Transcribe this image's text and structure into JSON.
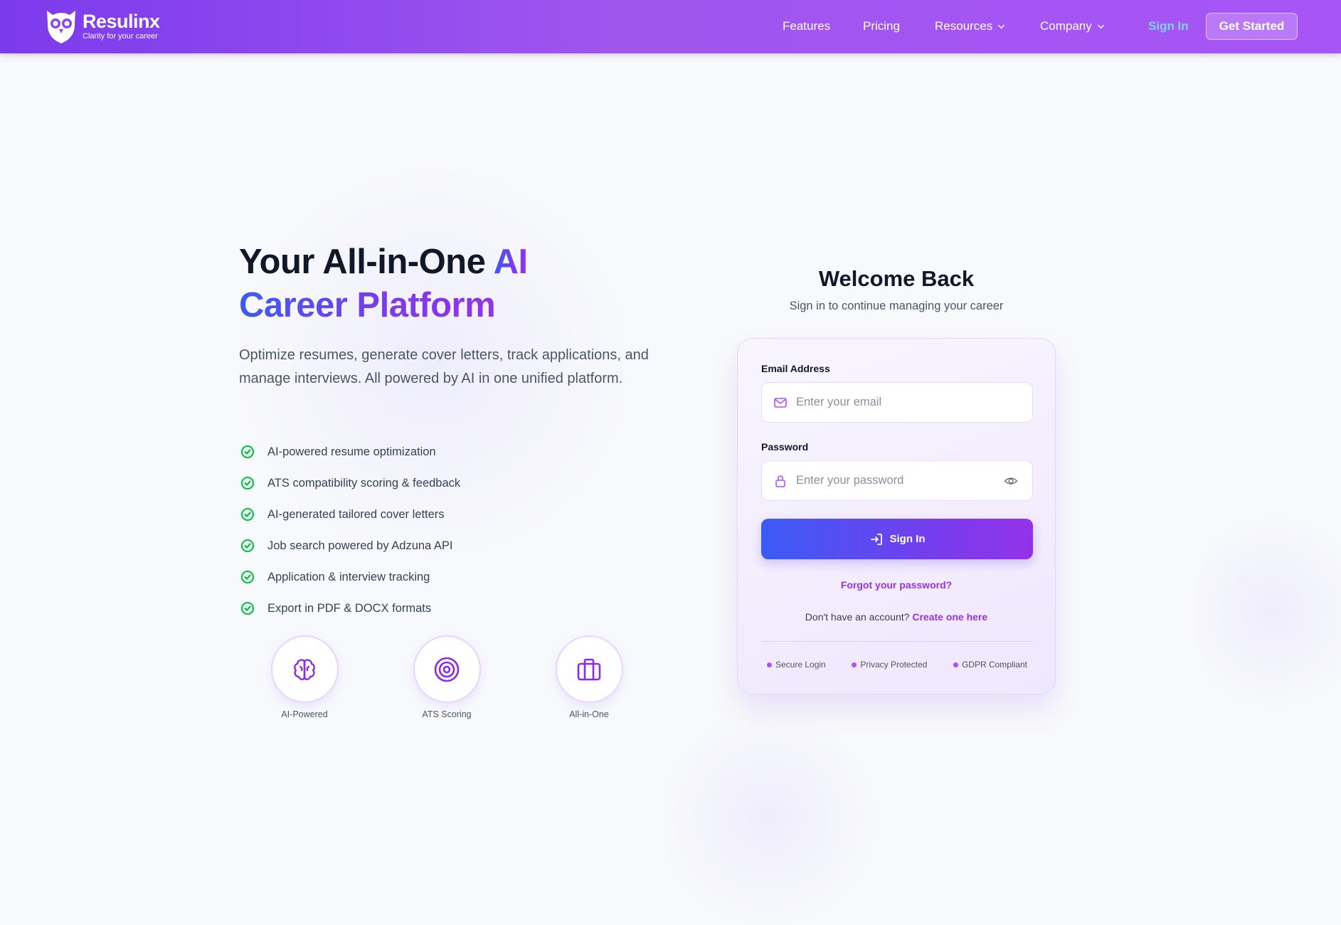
{
  "brand": {
    "name": "Resulinx",
    "tagline": "Clarity for your career"
  },
  "nav": {
    "links": [
      {
        "label": "Features"
      },
      {
        "label": "Pricing"
      },
      {
        "label": "Resources",
        "dropdown": true
      },
      {
        "label": "Company",
        "dropdown": true
      }
    ],
    "sign_in": "Sign In",
    "get_started": "Get Started"
  },
  "hero": {
    "title_part1": "Your All-in-One ",
    "title_highlight1": "AI",
    "title_highlight2": "Career Platform",
    "description": "Optimize resumes, generate cover letters, track applications, and manage interviews. All powered by AI in one unified platform.",
    "features": [
      "AI-powered resume optimization",
      "ATS compatibility scoring & feedback",
      "AI-generated tailored cover letters",
      "Job search powered by Adzuna API",
      "Application & interview tracking",
      "Export in PDF & DOCX formats"
    ],
    "badges": [
      {
        "label": "AI-Powered",
        "icon": "brain-icon"
      },
      {
        "label": "ATS Scoring",
        "icon": "target-icon"
      },
      {
        "label": "All-in-One",
        "icon": "briefcase-icon"
      }
    ]
  },
  "login": {
    "title": "Welcome Back",
    "subtitle": "Sign in to continue managing your career",
    "email_label": "Email Address",
    "email_placeholder": "Enter your email",
    "password_label": "Password",
    "password_placeholder": "Enter your password",
    "submit": "Sign In",
    "forgot": "Forgot your password?",
    "no_account": "Don't have an account?",
    "create": "Create one here",
    "trust": [
      "Secure Login",
      "Privacy Protected",
      "GDPR Compliant"
    ]
  },
  "colors": {
    "nav_start": "#7c3aed",
    "nav_end": "#a855f7",
    "accent": "#9333ea",
    "blue": "#3b5bf5",
    "check": "#22c55e"
  }
}
